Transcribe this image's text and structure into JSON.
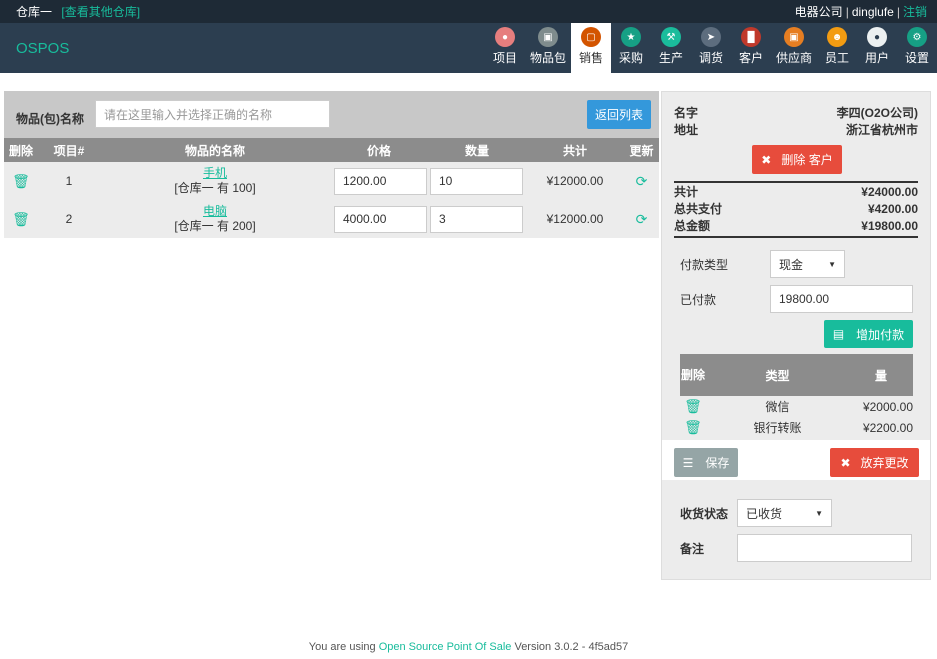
{
  "topbar": {
    "warehouse": "仓库一",
    "view_other": "[查看其他仓库]",
    "company": "电器公司",
    "user": "dinglufe",
    "logout": "注销"
  },
  "brand": "OSPOS",
  "nav": [
    {
      "label": "项目",
      "icon": "item-icon",
      "color": "#e67e7e"
    },
    {
      "label": "物品包",
      "icon": "item-kit-icon",
      "color": "#7f8c8d"
    },
    {
      "label": "销售",
      "icon": "sales-basket-icon",
      "color": "#d35400"
    },
    {
      "label": "采购",
      "icon": "receiving-icon",
      "color": "#16a085"
    },
    {
      "label": "生产",
      "icon": "production-wrench-icon",
      "color": "#1abc9c"
    },
    {
      "label": "调货",
      "icon": "transfer-rocket-icon",
      "color": "#5d6d7e"
    },
    {
      "label": "客户",
      "icon": "customer-icon",
      "color": "#c0392b"
    },
    {
      "label": "供应商",
      "icon": "supplier-icon",
      "color": "#e67e22"
    },
    {
      "label": "员工",
      "icon": "employee-icon",
      "color": "#f39c12"
    },
    {
      "label": "用户",
      "icon": "user-icon",
      "color": "#ecf0f1"
    },
    {
      "label": "设置",
      "icon": "settings-gear-icon",
      "color": "#16a085"
    }
  ],
  "register": {
    "item_label": "物品(包)名称",
    "search_placeholder": "请在这里输入并选择正确的名称",
    "return_list": "返回列表"
  },
  "cart": {
    "headers": [
      "删除",
      "项目#",
      "物品的名称",
      "价格",
      "数量",
      "共计",
      "更新"
    ],
    "rows": [
      {
        "no": "1",
        "name": "手机",
        "stock": "[仓库一 有 100]",
        "price": "1200.00",
        "qty": "10",
        "total": "¥12000.00"
      },
      {
        "no": "2",
        "name": "电脑",
        "stock": "[仓库一 有 200]",
        "price": "4000.00",
        "qty": "3",
        "total": "¥12000.00"
      }
    ]
  },
  "customer": {
    "name_label": "名字",
    "name_value": "李四(O2O公司)",
    "addr_label": "地址",
    "addr_value": "浙江省杭州市",
    "delete_btn": "删除 客户"
  },
  "totals": {
    "total_label": "共计",
    "total_value": "¥24000.00",
    "paid_label": "总共支付",
    "paid_value": "¥4200.00",
    "due_label": "总金额",
    "due_value": "¥19800.00"
  },
  "payment": {
    "type_label": "付款类型",
    "type_value": "现金",
    "paid_label": "已付款",
    "paid_value": "19800.00",
    "add_btn": "增加付款"
  },
  "payments_table": {
    "headers": [
      "删除",
      "类型",
      "量"
    ],
    "rows": [
      {
        "type": "微信",
        "amount": "¥2000.00"
      },
      {
        "type": "银行转账",
        "amount": "¥2200.00"
      }
    ]
  },
  "actions": {
    "save": "保存",
    "discard": "放弃更改"
  },
  "delivery": {
    "status_label": "收货状态",
    "status_value": "已收货",
    "note_label": "备注"
  },
  "footer": {
    "prefix": "You are using ",
    "link": "Open Source Point Of Sale",
    "suffix": " Version 3.0.2 - 4f5ad57"
  }
}
